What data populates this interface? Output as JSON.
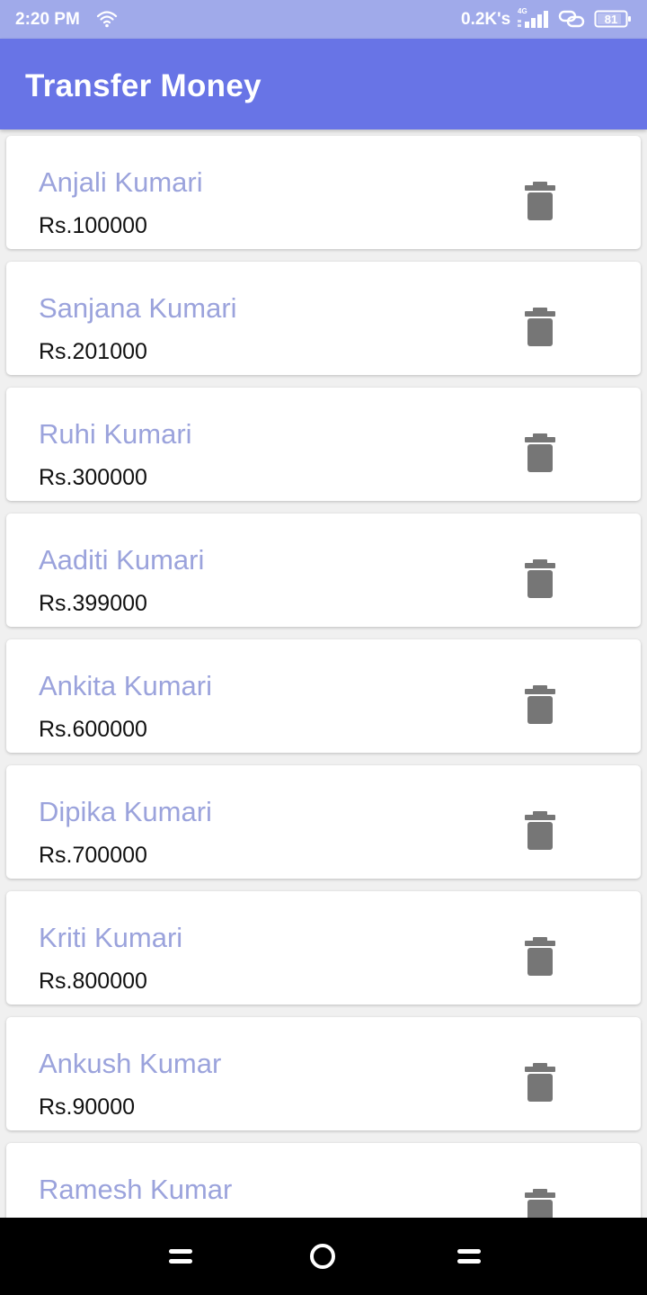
{
  "status_bar": {
    "time": "2:20 PM",
    "network_speed": "0.2K's",
    "network_type": "4G",
    "battery": "81",
    "icons": [
      "wifi-icon",
      "signal-icon",
      "link-icon",
      "battery-icon"
    ]
  },
  "app_bar": {
    "title": "Transfer Money"
  },
  "contacts": [
    {
      "name": "Anjali Kumari",
      "amount": "Rs.100000"
    },
    {
      "name": "Sanjana Kumari",
      "amount": "Rs.201000"
    },
    {
      "name": "Ruhi Kumari",
      "amount": "Rs.300000"
    },
    {
      "name": "Aaditi Kumari",
      "amount": "Rs.399000"
    },
    {
      "name": "Ankita Kumari",
      "amount": "Rs.600000"
    },
    {
      "name": "Dipika Kumari",
      "amount": "Rs.700000"
    },
    {
      "name": "Kriti Kumari",
      "amount": "Rs.800000"
    },
    {
      "name": "Ankush Kumar",
      "amount": "Rs.90000"
    },
    {
      "name": "Ramesh Kumar",
      "amount": ""
    }
  ],
  "item_icon": "trash-icon",
  "nav_bar": {
    "icons": [
      "menu-icon",
      "home-icon",
      "back-icon"
    ]
  },
  "colors": {
    "status_bar": "#a0aaea",
    "app_bar": "#6874e6",
    "name_text": "#9ba3dc",
    "amount_text": "#111111",
    "trash_icon": "#767676",
    "nav_bar": "#000000"
  }
}
